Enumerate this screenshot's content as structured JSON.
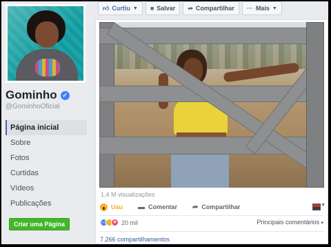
{
  "page": {
    "name": "Gominho",
    "handle": "@GominhoOficial"
  },
  "sidebar": {
    "items": [
      {
        "label": "Página inicial"
      },
      {
        "label": "Sobre"
      },
      {
        "label": "Fotos"
      },
      {
        "label": "Curtidas"
      },
      {
        "label": "Vídeos"
      },
      {
        "label": "Publicações"
      }
    ],
    "create_page_label": "Criar uma Página"
  },
  "toolbar": {
    "like_label": "Curtiu",
    "save_label": "Salvar",
    "share_label": "Compartilhar",
    "more_label": "Mais"
  },
  "post": {
    "views": "1,4 M visualizações",
    "actions": {
      "react_label": "Uau",
      "comment_label": "Comentar",
      "share_label": "Compartilhar"
    },
    "reactions_count": "20 mil",
    "comments_sort": "Principais comentários",
    "shares": "7.266 compartilhamentos"
  },
  "colors": {
    "brand_blue": "#4267b2",
    "link_blue": "#385898",
    "create_green": "#42b72a",
    "wow_yellow": "#f7b125"
  },
  "icons": [
    "verified-icon",
    "like-icon",
    "bookmark-icon",
    "share-icon",
    "more-icon",
    "wow-icon",
    "comment-icon",
    "flag-icon"
  ]
}
